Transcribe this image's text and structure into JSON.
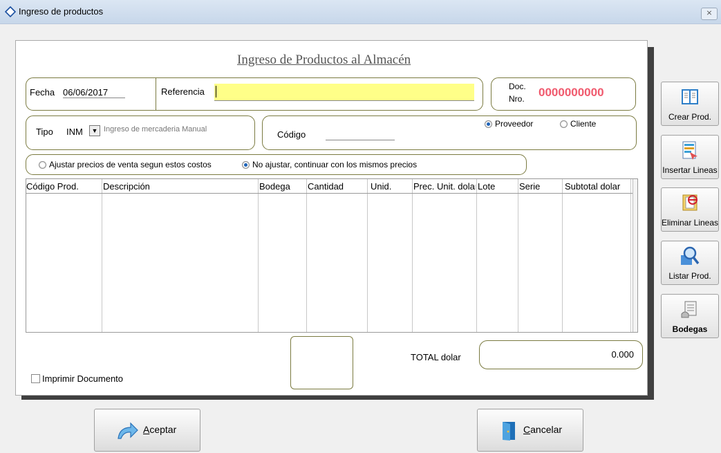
{
  "window": {
    "title": "Ingreso de productos",
    "close_glyph": "⨯"
  },
  "form": {
    "heading": "Ingreso de Productos al Almacén",
    "fecha_label": "Fecha",
    "fecha_value": "06/06/2017",
    "referencia_label": "Referencia",
    "referencia_value": "",
    "doc_label_1": "Doc.",
    "doc_label_2": "Nro.",
    "doc_number": "0000000000",
    "tipo_label": "Tipo",
    "tipo_value": "INM",
    "tipo_description": "Ingreso de mercaderia Manual",
    "codigo_label": "Código",
    "codigo_value": "",
    "party_options": [
      {
        "label": "Proveedor",
        "selected": true
      },
      {
        "label": "Cliente",
        "selected": false
      }
    ],
    "price_options": [
      {
        "label": "Ajustar precios de venta segun estos costos",
        "selected": false
      },
      {
        "label": "No ajustar, continuar con los mismos precios",
        "selected": true
      }
    ],
    "print_label": "Imprimir Documento",
    "print_checked": false,
    "total_label": "TOTAL dolar",
    "total_value": "0.000"
  },
  "table": {
    "columns": [
      "Código Prod.",
      "Descripción",
      "Bodega",
      "Cantidad",
      "Unid.",
      "Prec. Unit. dolar",
      "Lote",
      "Serie",
      "Subtotal dolar"
    ],
    "rows": []
  },
  "sidebar": [
    {
      "label": "Crear Prod.",
      "icon": "book-icon"
    },
    {
      "label": "Insertar Lineas",
      "icon": "insert-lines-icon"
    },
    {
      "label": "Eliminar Lineas",
      "icon": "delete-lines-icon"
    },
    {
      "label": "Listar Prod.",
      "icon": "search-icon"
    },
    {
      "label": "Bodegas",
      "icon": "warehouse-icon"
    }
  ],
  "buttons": {
    "accept_mnemonic": "A",
    "accept_rest": "ceptar",
    "cancel_mnemonic": "C",
    "cancel_rest": "ancelar"
  },
  "colors": {
    "doc_number": "#f05a6e",
    "reference_field": "#ffff88",
    "title_bar": "#c7d7ea"
  }
}
